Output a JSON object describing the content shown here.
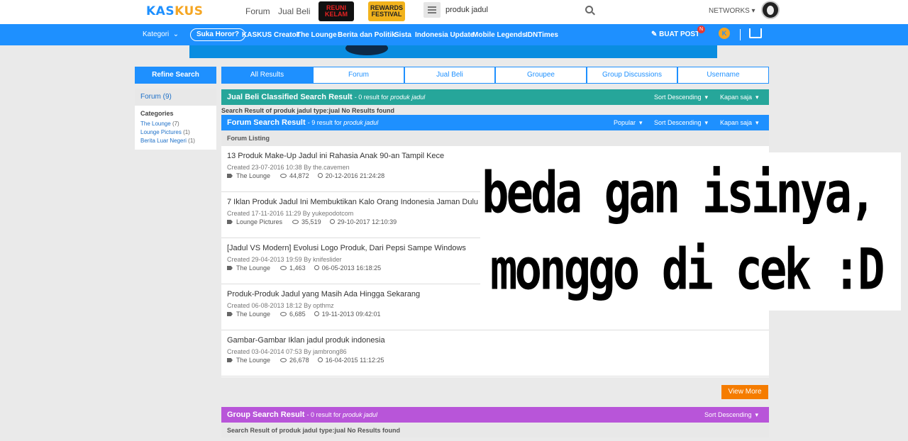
{
  "header": {
    "logo_prefix": "KAS",
    "logo_suffix": "KUS",
    "nav": [
      "Forum",
      "Jual Beli"
    ],
    "promo1": "REUNI KELAM",
    "promo2": "REWARDS FESTIVAL",
    "search_value": "produk jadul",
    "networks": "NETWORKS"
  },
  "bluebar": {
    "kategori": "Kategori",
    "suka": "Suka Horor?",
    "links": [
      "KASKUS Creator",
      "The Lounge",
      "Berita dan Politik",
      "Sista",
      "Indonesia Update",
      "Mobile Legends",
      "IDNTimes"
    ],
    "buat_post": "BUAT POST",
    "notif_count": "N",
    "k_icon": "K"
  },
  "sidebar": {
    "refine": "Refine Search",
    "forum": "Forum (9)",
    "categories_title": "Categories",
    "categories": [
      {
        "name": "The Lounge",
        "count": "(7)"
      },
      {
        "name": "Lounge Pictures",
        "count": "(1)"
      },
      {
        "name": "Berita Luar Negeri",
        "count": "(1)"
      }
    ]
  },
  "tabs": [
    "All Results",
    "Forum",
    "Jual Beli",
    "Groupee",
    "Group Discussions",
    "Username"
  ],
  "jualbeli": {
    "title": "Jual Beli Classified Search Result",
    "sub_prefix": "- 0 result for ",
    "query": "produk jadul",
    "sort": "Sort Descending",
    "time": "Kapan saja",
    "noresult": "Search Result of produk jadul type:jual No Results found"
  },
  "forum": {
    "title": "Forum Search Result",
    "sub_prefix": "- 9 result for ",
    "query": "produk jadul",
    "popular": "Popular",
    "sort": "Sort Descending",
    "time": "Kapan saja",
    "listing": "Forum Listing",
    "items": [
      {
        "title": "13 Produk Make-Up Jadul ini Rahasia Anak 90-an Tampil Kece",
        "meta": "Created 23-07-2016 10:38 By the.cavemen",
        "category": "The Lounge",
        "views": "44,872",
        "updated": "20-12-2016 21:24:28"
      },
      {
        "title": "7 Iklan Produk Jadul Ini Membuktikan Kalo Orang Indonesia Jaman Dulu Itu",
        "meta": "Created 17-11-2016 11:29 By yukepodotcom",
        "category": "Lounge Pictures",
        "views": "35,519",
        "updated": "29-10-2017 12:10:39"
      },
      {
        "title": "[Jadul VS Modern] Evolusi Logo Produk, Dari Pepsi Sampe Windows",
        "meta": "Created 29-04-2013 19:59 By knifeslider",
        "category": "The Lounge",
        "views": "1,463",
        "updated": "06-05-2013 16:18:25"
      },
      {
        "title": "Produk-Produk Jadul yang Masih Ada Hingga Sekarang",
        "meta": "Created 06-08-2013 18:12 By opthmz",
        "category": "The Lounge",
        "views": "6,685",
        "updated": "19-11-2013 09:42:01"
      },
      {
        "title": "Gambar-Gambar Iklan jadul produk indonesia",
        "meta": "Created 03-04-2014 07:53 By jambrong86",
        "category": "The Lounge",
        "views": "26,678",
        "updated": "16-04-2015 11:12:25"
      }
    ],
    "view_more": "View More"
  },
  "group": {
    "title": "Group Search Result",
    "sub_prefix": "- 0 result for ",
    "query": "produk jadul",
    "sort": "Sort Descending",
    "noresult": "Search Result of produk jadul type:jual No Results found"
  },
  "overlay": {
    "line1": "beda gan isinya,",
    "line2": "monggo di cek :D"
  },
  "colors": {
    "brand_blue": "#1e90ff",
    "teal": "#26a69a",
    "purple": "#b855d9",
    "orange": "#f57c00"
  }
}
